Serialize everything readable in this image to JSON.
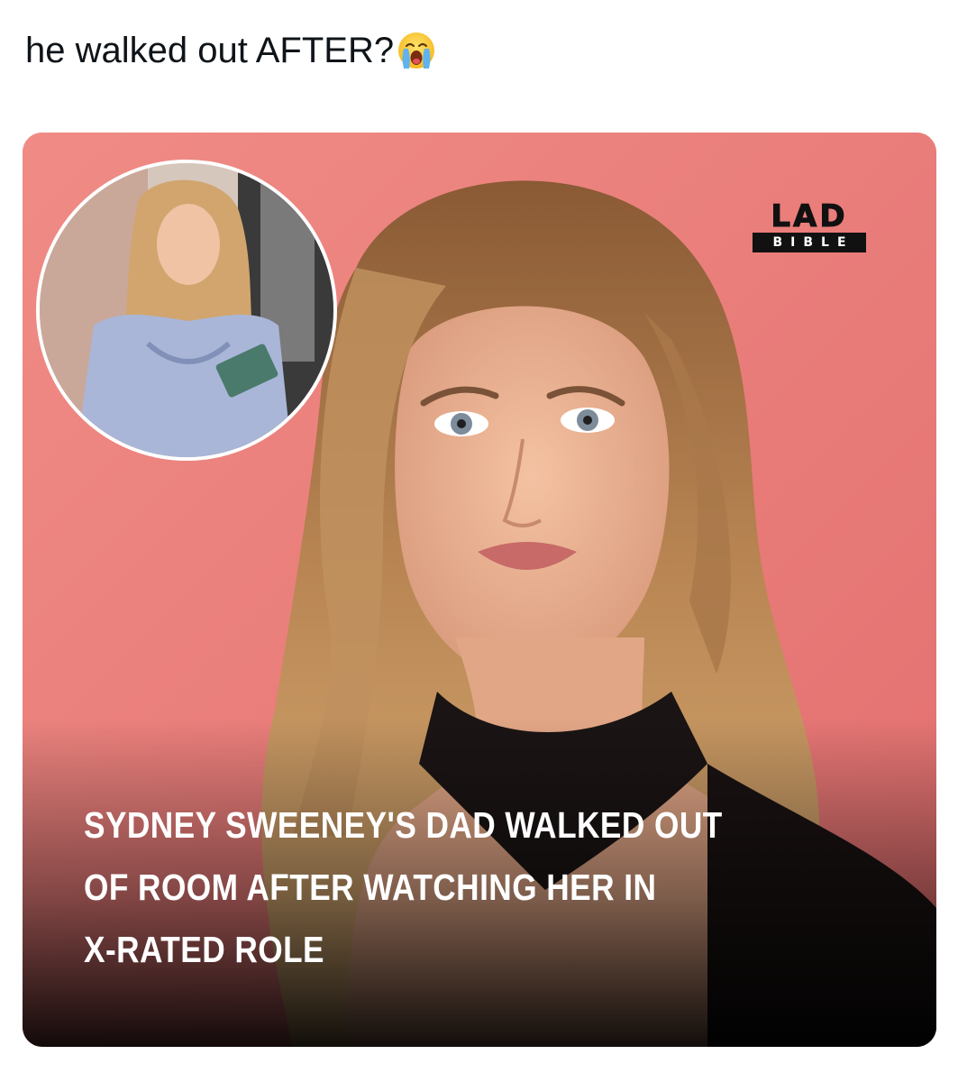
{
  "tweet": {
    "text": "he walked out AFTER?",
    "emoji_icon": "loudly-crying-face-icon"
  },
  "media": {
    "logo": {
      "top_word": "LAD",
      "bottom_word": "BIBLE"
    },
    "headline_lines": [
      "SYDNEY SWEENEY'S DAD WALKED OUT",
      "OF ROOM AFTER WATCHING HER IN",
      "X-RATED ROLE"
    ],
    "colors": {
      "background_pink": "#e97d7b",
      "headline_text": "#ffffff"
    }
  }
}
